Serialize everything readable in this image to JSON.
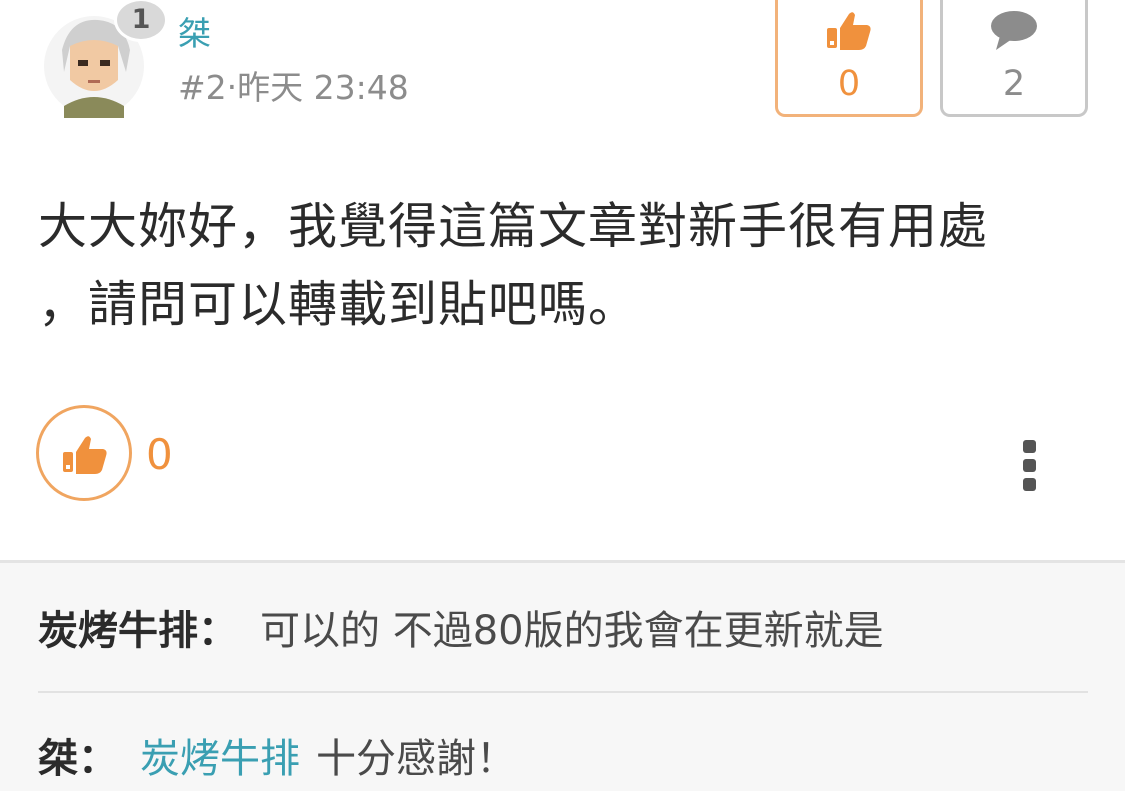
{
  "post": {
    "author": "桀",
    "badge": "1",
    "meta": "#2‧昨天 23:48",
    "content_line1": "大大妳好，我覺得這篇文章對新手很有用處",
    "content_line2": "，請問可以轉載到貼吧嗎。",
    "like_count": "0",
    "comment_count": "2",
    "inline_like_count": "0"
  },
  "comments": [
    {
      "name": "炭烤牛排",
      "sep": "：",
      "text": "可以的 不過80版的我會在更新就是"
    },
    {
      "name": "桀",
      "sep": "：",
      "mention": "炭烤牛排",
      "text": "十分感謝！"
    }
  ],
  "colors": {
    "accent_orange": "#f0913d",
    "link_teal": "#3a9fb2",
    "muted_gray": "#8c8c8c"
  },
  "icons": [
    "avatar-image",
    "thumbs-up-icon",
    "comment-bubble-icon",
    "more-vertical-icon"
  ]
}
